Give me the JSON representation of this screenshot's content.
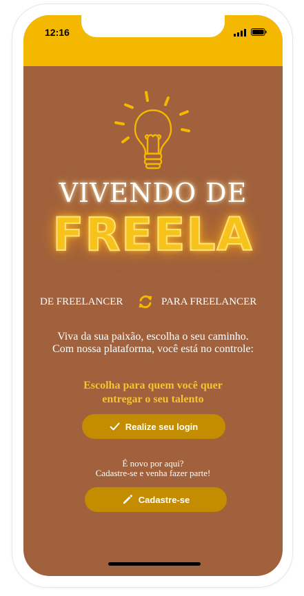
{
  "status_bar": {
    "time": "12:16",
    "color": "#f4b800",
    "icons": [
      "signal-icon",
      "battery-icon"
    ]
  },
  "hero": {
    "logo_icon": "lightbulb-icon",
    "title_line1": "VIVENDO DE",
    "title_line2": "FREELA"
  },
  "tagline": {
    "left": "DE FREELANCER",
    "icon": "sync-icon",
    "right": "PARA FREELANCER"
  },
  "description": {
    "line1": "Viva da sua paixão, escolha o seu caminho.",
    "line2": "Com nossa plataforma, você está no controle:"
  },
  "choose": {
    "line1": "Escolha para quem você quer",
    "line2": "entregar o seu talento"
  },
  "login_button": {
    "label": "Realize seu login",
    "icon": "check-icon"
  },
  "new_here": {
    "line1": "É novo por aqui?",
    "line2": "Cadastre-se e venha fazer parte!"
  },
  "signup_button": {
    "label": "Cadastre-se",
    "icon": "pencil-icon"
  },
  "colors": {
    "background": "#a0613c",
    "accent": "#f4b800",
    "button": "#c48c00",
    "highlight_text": "#f5c52b"
  }
}
